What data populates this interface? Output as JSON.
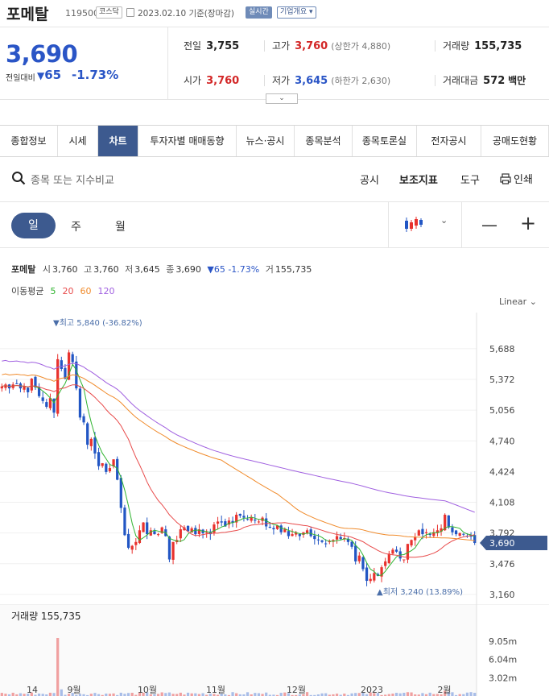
{
  "header": {
    "stock_name": "포메탈",
    "stock_code": "119500",
    "market": "코스닥",
    "date_label": "2023.02.10 기준(장마감)",
    "realtime_label": "실시간",
    "company_info_label": "기업개요 ▾"
  },
  "price": {
    "current": "3,690",
    "change_label": "전일대비",
    "change_amount": "65",
    "change_percent": "-1.73%",
    "direction_color": "#2a55c6"
  },
  "stats": {
    "prev_close": {
      "label": "전일",
      "value": "3,755"
    },
    "high": {
      "label": "고가",
      "value": "3,760",
      "sub": "(상한가 4,880)"
    },
    "volume": {
      "label": "거래량",
      "value": "155,735"
    },
    "open": {
      "label": "시가",
      "value": "3,760"
    },
    "low": {
      "label": "저가",
      "value": "3,645",
      "sub": "(하한가 2,630)"
    },
    "amount": {
      "label": "거래대금",
      "value": "572",
      "unit": "백만"
    }
  },
  "tabs": [
    "종합정보",
    "시세",
    "차트",
    "투자자별 매매동향",
    "뉴스·공시",
    "종목분석",
    "종목토론실",
    "전자공시",
    "공매도현황"
  ],
  "active_tab": "차트",
  "toolbar": {
    "search_placeholder": "종목 또는 지수비교",
    "notice": "공시",
    "indicators": "보조지표",
    "tools": "도구",
    "print": "인쇄"
  },
  "period": {
    "day": "일",
    "week": "주",
    "month": "월"
  },
  "legend": {
    "name": "포메탈",
    "open_label": "시",
    "open": "3,760",
    "high_label": "고",
    "high": "3,760",
    "low_label": "저",
    "low": "3,645",
    "close_label": "종",
    "close": "3,690",
    "change": "▼65 -1.73%",
    "volume_label": "거",
    "volume": "155,735",
    "ma_label": "이동평균",
    "ma": [
      {
        "period": "5",
        "color": "#2fb32f"
      },
      {
        "period": "20",
        "color": "#e84a4a"
      },
      {
        "period": "60",
        "color": "#f08a2a"
      },
      {
        "period": "120",
        "color": "#a060e0"
      }
    ],
    "scale": "Linear"
  },
  "volume_label": "거래량 155,735",
  "colors": {
    "up": "#e8322e",
    "down": "#2256c4",
    "accent": "#3d5a8f"
  },
  "chart_data": {
    "type": "candlestick",
    "y_ticks": [
      5688,
      5372,
      5056,
      4740,
      4424,
      4108,
      3792,
      3476,
      3160
    ],
    "y_tick_labels": [
      "5,688",
      "5,372",
      "5,056",
      "4,740",
      "4,424",
      "4,108",
      "3,792",
      "3,476",
      "3,160"
    ],
    "ylim": [
      3060,
      6060
    ],
    "x_labels": [
      "14",
      "9월",
      "10월",
      "11월",
      "12월",
      "2023",
      "2월"
    ],
    "current_price_label": "3,690",
    "max_annotation": "▼최고 5,840 (-36.82%)",
    "min_annotation": "▲최저 3,240 (13.89%)",
    "close": [
      5300,
      5320,
      5280,
      5320,
      5330,
      5280,
      5300,
      5240,
      5380,
      5290,
      5200,
      5150,
      5090,
      5180,
      5030,
      5580,
      5480,
      5380,
      5650,
      5550,
      5280,
      4980,
      4930,
      4700,
      4760,
      4610,
      4480,
      4510,
      4420,
      4460,
      4550,
      4340,
      4050,
      3770,
      3640,
      3660,
      3700,
      3820,
      3900,
      3780,
      3820,
      3780,
      3780,
      3850,
      3760,
      3520,
      3700,
      3720,
      3830,
      3850,
      3810,
      3840,
      3780,
      3830,
      3790,
      3800,
      3780,
      3880,
      3910,
      3900,
      3860,
      3920,
      3900,
      3980,
      3970,
      3950,
      3930,
      3950,
      3920,
      3910,
      3950,
      3860,
      3850,
      3830,
      3870,
      3800,
      3830,
      3760,
      3780,
      3800,
      3760,
      3800,
      3820,
      3760,
      3730,
      3720,
      3700,
      3680,
      3710,
      3720,
      3760,
      3730,
      3740,
      3700,
      3650,
      3500,
      3560,
      3420,
      3300,
      3320,
      3380,
      3350,
      3440,
      3500,
      3580,
      3620,
      3600,
      3530,
      3520,
      3680,
      3720,
      3750,
      3820,
      3780,
      3800,
      3780,
      3800,
      3820,
      3840,
      3980,
      3850,
      3800,
      3780,
      3790,
      3780,
      3760,
      3755,
      3690
    ],
    "volume_axis_labels": [
      "9.05m",
      "6.04m",
      "3.02m"
    ]
  }
}
